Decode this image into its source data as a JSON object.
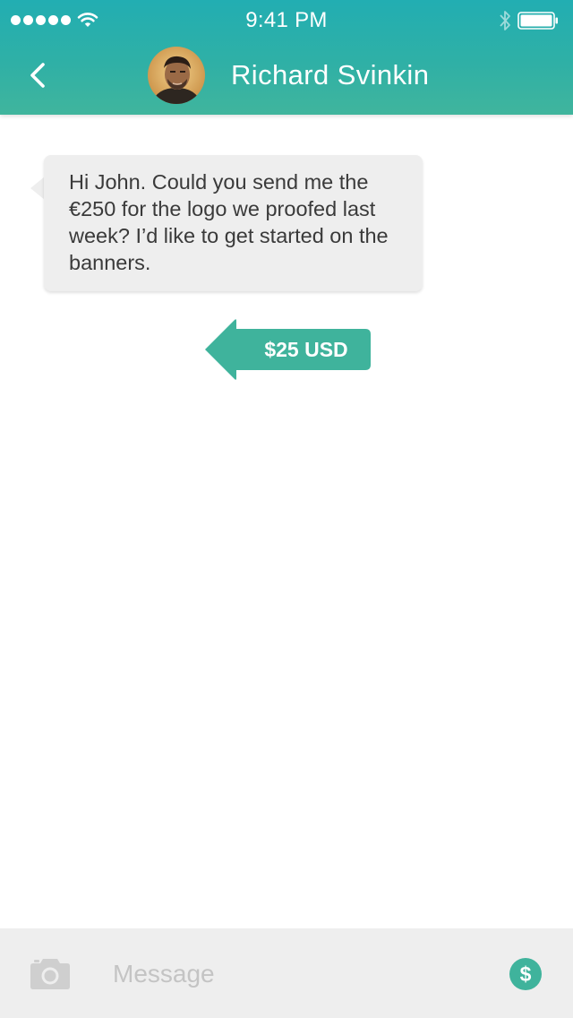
{
  "status_bar": {
    "signal_icon": "signal-dots-icon",
    "wifi_icon": "wifi-icon",
    "time": "9:41 PM",
    "bluetooth_icon": "bluetooth-icon",
    "battery_icon": "battery-icon"
  },
  "header": {
    "back_icon": "chevron-left-icon",
    "contact_name": "Richard Svinkin",
    "avatar": "contact-avatar"
  },
  "messages": [
    {
      "direction": "incoming",
      "text": "Hi John. Could you send me the €250 for the logo we proofed last week? I’d like to get started on the banners."
    },
    {
      "direction": "outgoing",
      "type": "payment",
      "amount": "$25 USD"
    }
  ],
  "input_bar": {
    "camera_icon": "camera-icon",
    "placeholder": "Message",
    "value": "",
    "payment_button_label": "$"
  },
  "colors": {
    "header_top": "#22aeb2",
    "header_bottom": "#40b59d",
    "accent": "#3fb39c",
    "bubble_bg": "#eeeeee",
    "input_bar_bg": "#eeeeee"
  }
}
